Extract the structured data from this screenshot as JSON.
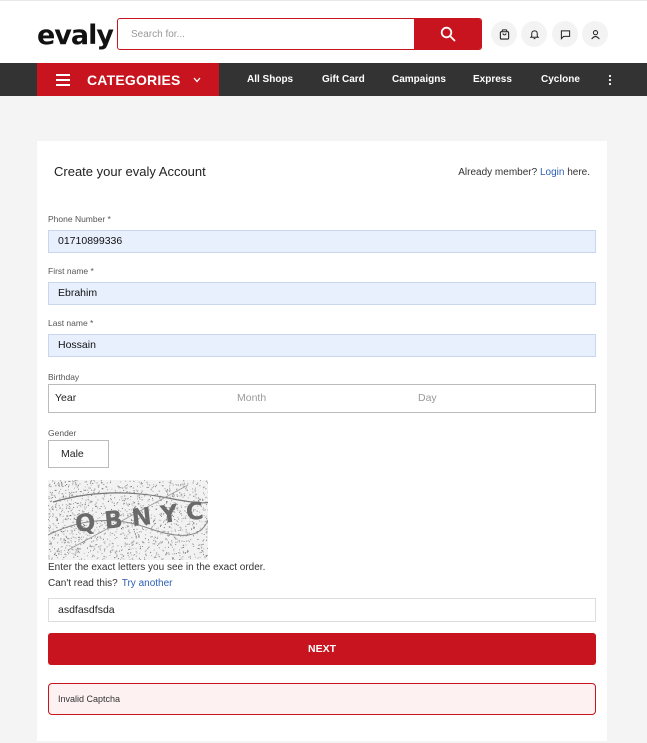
{
  "header": {
    "logo": "evaly",
    "search": {
      "placeholder": "Search for...",
      "value": ""
    },
    "icons": [
      "shopping-bag-icon",
      "bell-icon",
      "chat-icon",
      "user-icon"
    ]
  },
  "nav": {
    "categories_label": "CATEGORIES",
    "links": [
      "All Shops",
      "Gift Card",
      "Campaigns",
      "Express",
      "Cyclone"
    ]
  },
  "form": {
    "title": "Create your evaly Account",
    "already_member": "Already member?",
    "login_link": "Login",
    "here": "here.",
    "phone": {
      "label": "Phone Number *",
      "value": "01710899336"
    },
    "first_name": {
      "label": "First name *",
      "value": "Ebrahim"
    },
    "last_name": {
      "label": "Last name *",
      "value": "Hossain"
    },
    "birthday": {
      "label": "Birthday",
      "year": "Year",
      "month": "Month",
      "day": "Day"
    },
    "gender": {
      "label": "Gender",
      "value": "Male"
    },
    "captcha": {
      "text": "QBNYC",
      "hint": "Enter the exact letters you see in the exact order.",
      "cant_read": "Can't read this?",
      "try_another": "Try another",
      "value": "asdfasdfsda"
    },
    "next_label": "NEXT",
    "error": "Invalid Captcha"
  },
  "colors": {
    "accent": "#c8141e",
    "nav_bg": "#333333",
    "autofill_bg": "#e8f0fe",
    "link": "#2d5fb5"
  }
}
